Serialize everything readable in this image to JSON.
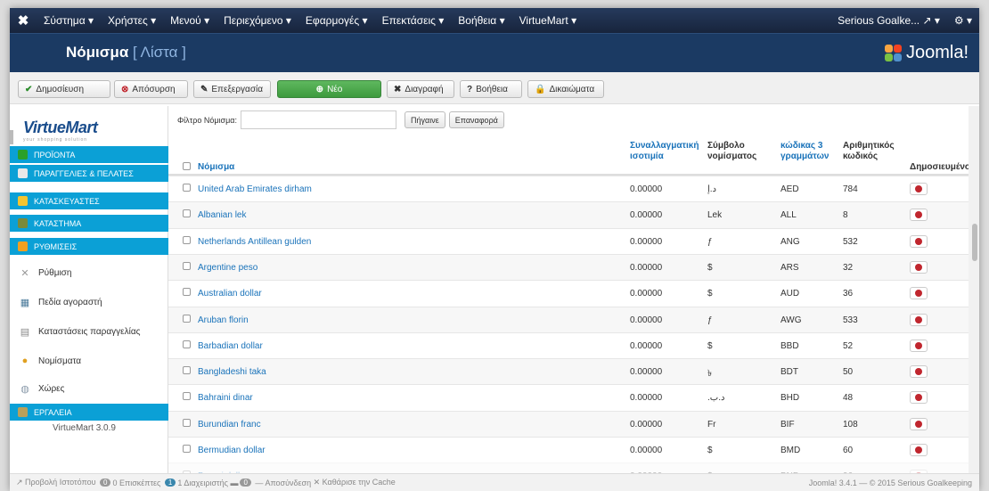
{
  "topbar": {
    "menus": [
      "Σύστημα ▾",
      "Χρήστες ▾",
      "Μενού ▾",
      "Περιεχόμενο ▾",
      "Εφαρμογές ▾",
      "Επεκτάσεις ▾",
      "Βοήθεια ▾",
      "VirtueMart ▾"
    ],
    "user": "Serious Goalke... ↗ ▾",
    "settings": "⚙ ▾"
  },
  "header": {
    "title": "Νόμισμα",
    "subtitle": "[ Λίστα ]",
    "brand": "Joomla!"
  },
  "toolbar": {
    "publish": "Δημοσίευση",
    "unpublish": "Απόσυρση",
    "edit": "Επεξεργασία",
    "new": "Νέο",
    "delete": "Διαγραφή",
    "help": "Βοήθεια",
    "permissions": "Δικαιώματα"
  },
  "sidebar": {
    "logo": "VirtueMart",
    "tagline": "your shopping solution",
    "categories": [
      {
        "label": "ΠΡΟΪΟΝΤΑ",
        "color": "#2aa02a"
      },
      {
        "label": "ΠΑΡΑΓΓΕΛΙΕΣ & ΠΕΛΑΤΕΣ",
        "color": "#e8e8e8"
      },
      {
        "label": "ΚΑΤΑΣΚΕΥΑΣΤΕΣ",
        "color": "#f4c430"
      },
      {
        "label": "ΚΑΤΑΣΤΗΜΑ",
        "color": "#7a8a3a"
      },
      {
        "label": "ΡΥΘΜΙΣΕΙΣ",
        "color": "#f0a020"
      }
    ],
    "items": [
      {
        "label": "Ρύθμιση",
        "icon": "wrench-icon"
      },
      {
        "label": "Πεδία αγοραστή",
        "icon": "form-icon"
      },
      {
        "label": "Καταστάσεις παραγγελίας",
        "icon": "document-icon"
      },
      {
        "label": "Νομίσματα",
        "icon": "coins-icon"
      },
      {
        "label": "Χώρες",
        "icon": "globe-icon"
      }
    ],
    "tools": "ΕΡΓΑΛΕΙΑ",
    "version": "VirtueMart 3.0.9"
  },
  "filter": {
    "label": "Φίλτρο Νόμισμα:",
    "value": "",
    "go": "Πήγαινε",
    "reset": "Επαναφορά"
  },
  "table": {
    "headers": {
      "name": "Νόμισμα",
      "rate": [
        "Συναλλαγματική",
        "ισοτιμία"
      ],
      "symbol": [
        "Σύμβολο",
        "νομίσματος"
      ],
      "code3": [
        "κώδικας 3",
        "γραμμάτων"
      ],
      "numeric": [
        "Αριθμητικός",
        "κωδικός"
      ],
      "published": "Δημοσιευμένο"
    },
    "rows": [
      {
        "name": "United Arab Emirates dirham",
        "rate": "0.00000",
        "symbol": "د.إ",
        "code": "AED",
        "num": "784"
      },
      {
        "name": "Albanian lek",
        "rate": "0.00000",
        "symbol": "Lek",
        "code": "ALL",
        "num": "8"
      },
      {
        "name": "Netherlands Antillean gulden",
        "rate": "0.00000",
        "symbol": "ƒ",
        "code": "ANG",
        "num": "532"
      },
      {
        "name": "Argentine peso",
        "rate": "0.00000",
        "symbol": "$",
        "code": "ARS",
        "num": "32"
      },
      {
        "name": "Australian dollar",
        "rate": "0.00000",
        "symbol": "$",
        "code": "AUD",
        "num": "36"
      },
      {
        "name": "Aruban florin",
        "rate": "0.00000",
        "symbol": "ƒ",
        "code": "AWG",
        "num": "533"
      },
      {
        "name": "Barbadian dollar",
        "rate": "0.00000",
        "symbol": "$",
        "code": "BBD",
        "num": "52"
      },
      {
        "name": "Bangladeshi taka",
        "rate": "0.00000",
        "symbol": "৳",
        "code": "BDT",
        "num": "50"
      },
      {
        "name": "Bahraini dinar",
        "rate": "0.00000",
        "symbol": ".د.ب",
        "code": "BHD",
        "num": "48"
      },
      {
        "name": "Burundian franc",
        "rate": "0.00000",
        "symbol": "Fr",
        "code": "BIF",
        "num": "108"
      },
      {
        "name": "Bermudian dollar",
        "rate": "0.00000",
        "symbol": "$",
        "code": "BMD",
        "num": "60"
      },
      {
        "name": "Brunei dollar",
        "rate": "0.00000",
        "symbol": "$",
        "code": "BND",
        "num": "96"
      }
    ]
  },
  "status": {
    "view_site": "Προβολή Ιστοτόπου",
    "visitors_count": "0",
    "visitors": "Επισκέπτες",
    "admins_count": "1",
    "admins": "Διαχειριστής",
    "messages_count": "0",
    "logout": "Αποσύνδεση",
    "clear_cache": "Καθάρισε την Cache",
    "copyright": "Joomla! 3.4.1 — © 2015 Serious Goalkeeping"
  }
}
